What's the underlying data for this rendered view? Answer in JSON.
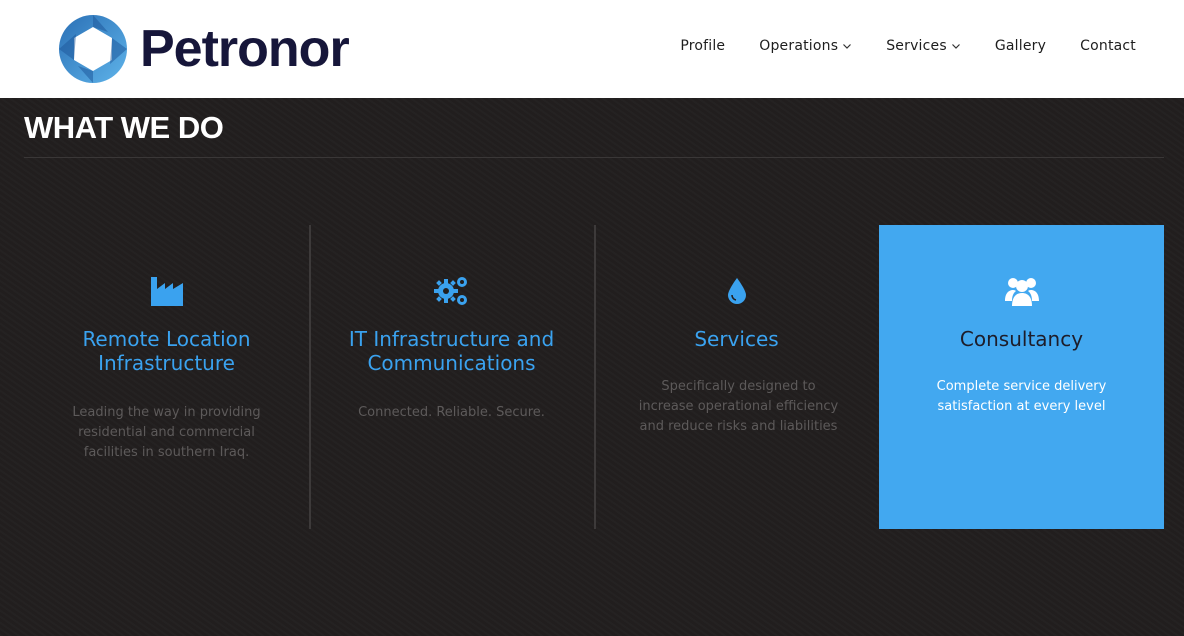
{
  "brand": {
    "name": "Petronor"
  },
  "nav": {
    "items": [
      {
        "label": "Profile",
        "has_dropdown": false
      },
      {
        "label": "Operations",
        "has_dropdown": true
      },
      {
        "label": "Services",
        "has_dropdown": true
      },
      {
        "label": "Gallery",
        "has_dropdown": false
      },
      {
        "label": "Contact",
        "has_dropdown": false
      }
    ]
  },
  "section": {
    "title": "WHAT WE DO"
  },
  "cards": [
    {
      "icon": "factory-icon",
      "title": "Remote Location Infrastructure",
      "description": "Leading the way in providing residential and commercial facilities in southern Iraq.",
      "active": false
    },
    {
      "icon": "gears-icon",
      "title": "IT Infrastructure and Communications",
      "description": "Connected. Reliable. Secure.",
      "active": false
    },
    {
      "icon": "drop-icon",
      "title": "Services",
      "description": "Specifically designed to increase operational efficiency and reduce risks and liabilities",
      "active": false
    },
    {
      "icon": "group-icon",
      "title": "Consultancy",
      "description": "Complete service delivery satisfaction at every level",
      "active": true
    }
  ],
  "colors": {
    "accent": "#42a8f0",
    "title_blue": "#3aa2ef",
    "background": "#221f1f",
    "brand_text": "#16163a"
  }
}
